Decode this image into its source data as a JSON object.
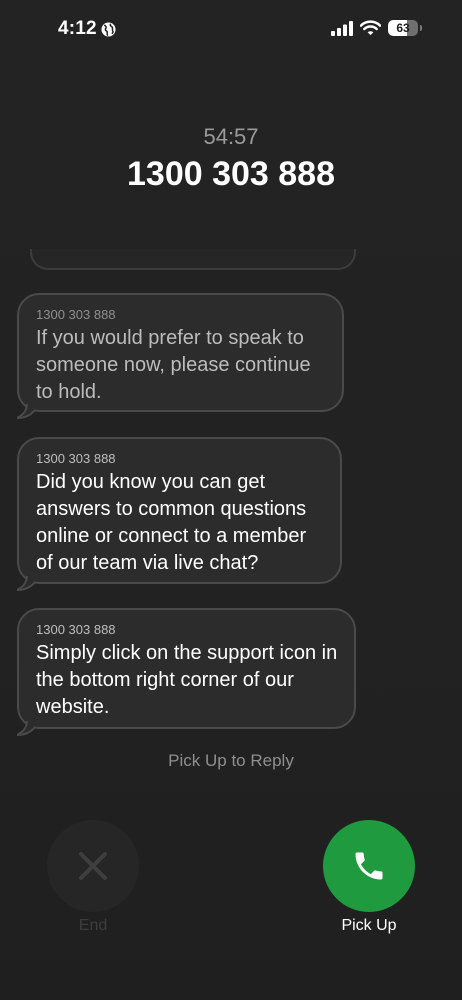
{
  "status_bar": {
    "time": "4:12",
    "time_icon": "globe-icon",
    "battery_level": 63,
    "battery_text": "63",
    "icons": [
      "signal-icon",
      "wifi-icon",
      "battery-icon"
    ]
  },
  "call": {
    "timer": "54:57",
    "caller": "1300 303 888"
  },
  "messages": [
    {
      "sender": "1300 303 888",
      "text": " If you would prefer to speak to someone now, please continue to hold.",
      "faded": true
    },
    {
      "sender": "1300 303 888",
      "text": " Did you know you can get answers to common questions online or connect to a member of our team via live chat?",
      "faded": false
    },
    {
      "sender": "1300 303 888",
      "text": " Simply click on the support icon in the bottom right corner of our website.",
      "faded": false
    }
  ],
  "pickup_hint": "Pick Up to Reply",
  "controls": {
    "end_label": "End",
    "end_icon": "close-icon",
    "pickup_label": "Pick Up",
    "pickup_icon": "phone-icon",
    "pickup_color": "#1f9a3e"
  }
}
